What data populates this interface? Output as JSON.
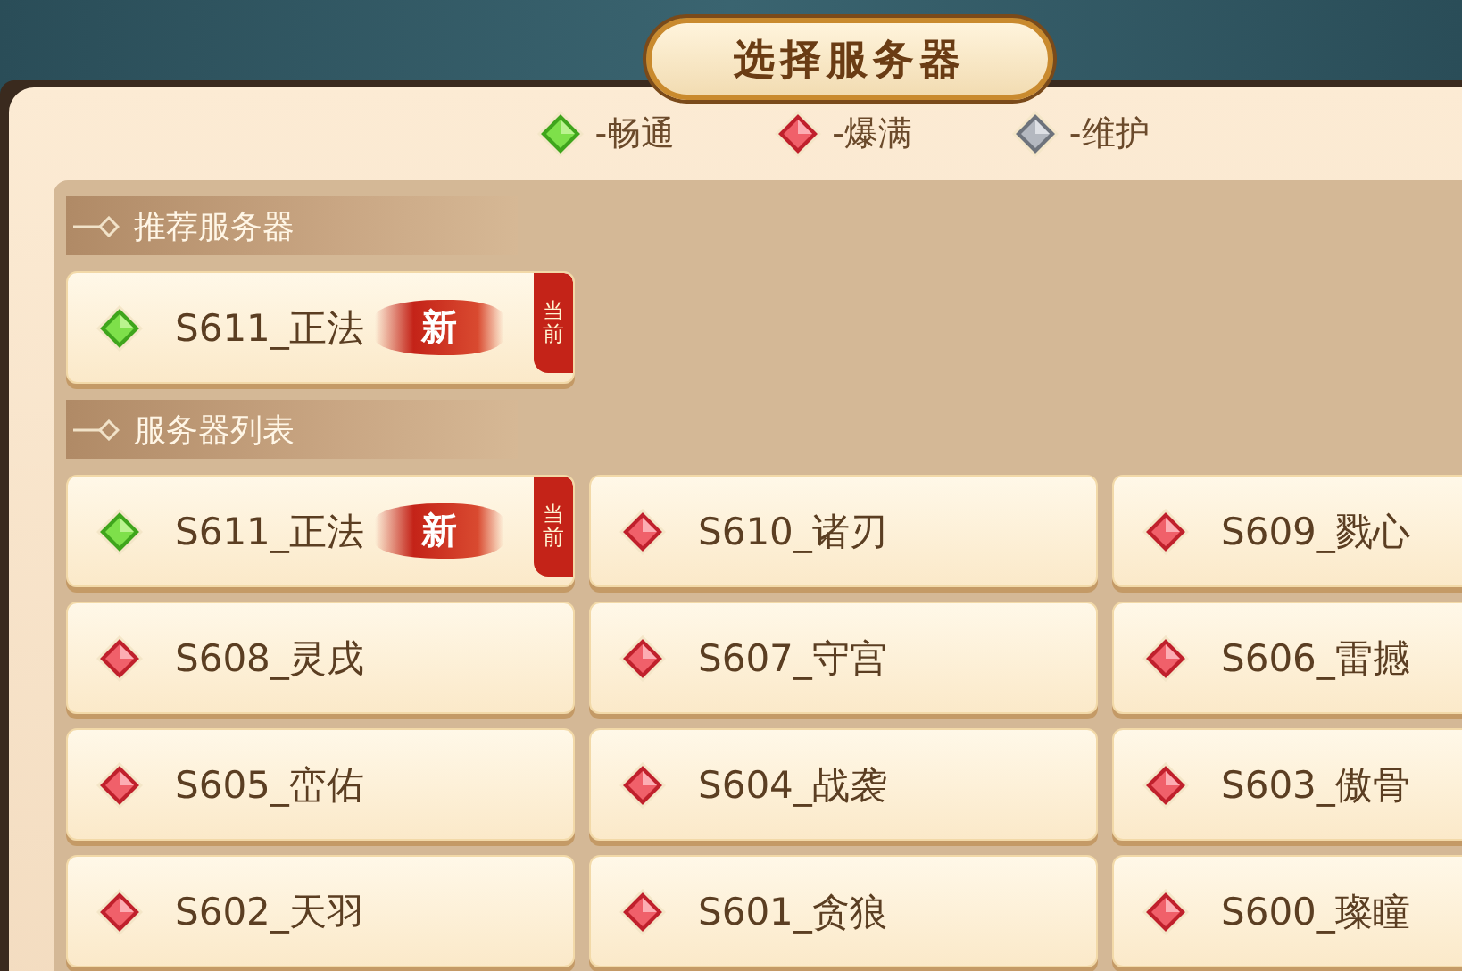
{
  "title": "选择服务器",
  "legend": [
    {
      "kind": "smooth",
      "label": "-畅通"
    },
    {
      "kind": "full",
      "label": "-爆满"
    },
    {
      "kind": "maintenance",
      "label": "-维护"
    }
  ],
  "sections": [
    {
      "title": "推荐服务器",
      "servers": [
        {
          "name": "S611_正法",
          "kind": "smooth",
          "badge": "新",
          "current": true,
          "current_label": "当前"
        }
      ]
    },
    {
      "title": "服务器列表",
      "servers": [
        {
          "name": "S611_正法",
          "kind": "smooth",
          "badge": "新",
          "current": true,
          "current_label": "当前"
        },
        {
          "name": "S610_诸刃",
          "kind": "full",
          "current": false
        },
        {
          "name": "S609_戮心",
          "kind": "full",
          "current": false
        },
        {
          "name": "S608_灵戌",
          "kind": "full",
          "current": false
        },
        {
          "name": "S607_守宫",
          "kind": "full",
          "current": false
        },
        {
          "name": "S606_雷撼",
          "kind": "full",
          "current": false
        },
        {
          "name": "S605_峦佑",
          "kind": "full",
          "current": false
        },
        {
          "name": "S604_战袭",
          "kind": "full",
          "current": false
        },
        {
          "name": "S603_傲骨",
          "kind": "full",
          "current": false
        },
        {
          "name": "S602_天羽",
          "kind": "full",
          "current": false
        },
        {
          "name": "S601_贪狼",
          "kind": "full",
          "current": false
        },
        {
          "name": "S600_璨瞳",
          "kind": "full",
          "current": false
        }
      ]
    }
  ]
}
